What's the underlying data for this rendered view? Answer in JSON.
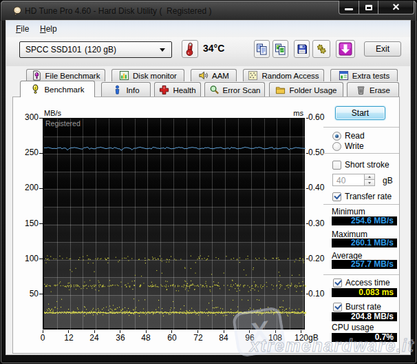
{
  "window": {
    "title": "HD Tune Pro 4.60 - Hard Disk Utility (  Registered )"
  },
  "menu": {
    "file_label": "File",
    "help_label": "Help"
  },
  "toolbar": {
    "drive_name": "SPCC SSD101",
    "drive_capacity": "(120 gB)",
    "temperature": "34°C",
    "exit_label": "Exit"
  },
  "tabs": {
    "row1": [
      {
        "label": "File Benchmark"
      },
      {
        "label": "Disk monitor"
      },
      {
        "label": "AAM"
      },
      {
        "label": "Random Access"
      },
      {
        "label": "Extra tests"
      }
    ],
    "row2": [
      {
        "label": "Benchmark"
      },
      {
        "label": "Info"
      },
      {
        "label": "Health"
      },
      {
        "label": "Error Scan"
      },
      {
        "label": "Folder Usage"
      },
      {
        "label": "Erase"
      }
    ],
    "active": "Benchmark"
  },
  "panel": {
    "start_label": "Start",
    "read_label": "Read",
    "write_label": "Write",
    "short_stroke_label": "Short stroke",
    "short_stroke_value": "40",
    "short_stroke_unit": "gB",
    "transfer_rate_label": "Transfer rate",
    "minimum_label": "Minimum",
    "minimum_value": "254.6 MB/s",
    "maximum_label": "Maximum",
    "maximum_value": "260.1 MB/s",
    "average_label": "Average",
    "average_value": "257.7 MB/s",
    "access_time_label": "Access time",
    "access_time_value": "0.083 ms",
    "burst_rate_label": "Burst rate",
    "burst_rate_value": "204.8 MB/s",
    "cpu_usage_label": "CPU usage",
    "cpu_usage_value": "0.7%"
  },
  "chart_data": {
    "type": "line+scatter",
    "x_axis": {
      "label": "gB",
      "min": 0,
      "max": 121.6,
      "ticks": [
        0,
        12,
        24,
        36,
        48,
        60,
        72,
        84,
        96,
        108,
        120
      ],
      "grid_interval": 6
    },
    "y_axis_left": {
      "label": "MB/s",
      "min": 0,
      "max": 300,
      "ticks": [
        300,
        250,
        200,
        150,
        100,
        50
      ],
      "grid_interval": 25
    },
    "y_axis_right": {
      "label": "ms",
      "min": 0,
      "max": 0.6,
      "ticks": [
        "0.60",
        "0.50",
        "0.40",
        "0.30",
        "0.20",
        "0.10"
      ]
    },
    "series": [
      {
        "name": "transfer_rate",
        "type": "line",
        "color": "#62a4da",
        "unit": "MB/s",
        "mean": 257.7,
        "min": 254.6,
        "max": 260.1
      },
      {
        "name": "access_time",
        "type": "scatter",
        "color": "#dcdc46",
        "unit": "ms",
        "average": 0.083,
        "bands_ms": [
          [
            0.048,
            0.062
          ],
          [
            0.105,
            0.148
          ],
          [
            0.185,
            0.215
          ]
        ]
      }
    ],
    "overlay_text": "Registered"
  },
  "watermark": {
    "text": "xtremehardware.it",
    "badge_letter": "X"
  }
}
